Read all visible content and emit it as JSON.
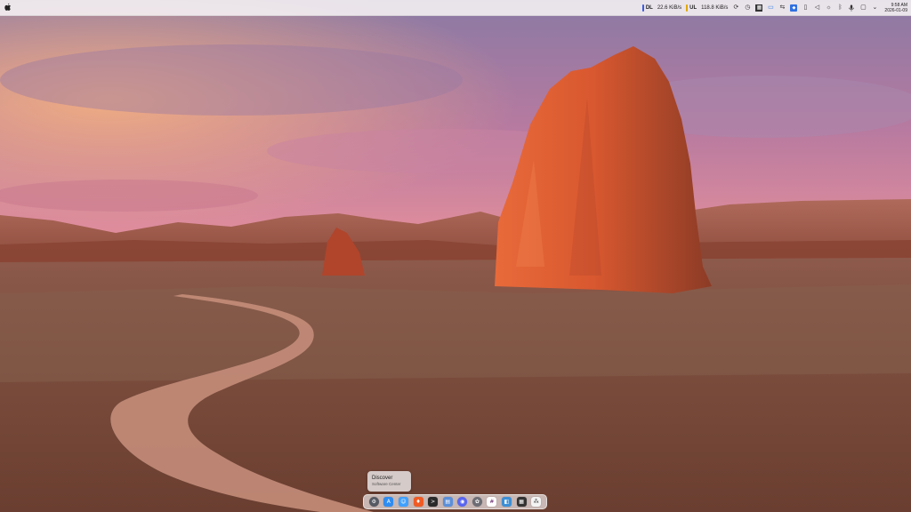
{
  "menubar": {
    "network": {
      "down_label": "DL",
      "down_rate": "22.6 KiB/s",
      "up_label": "UL",
      "up_rate": "118.8 KiB/s",
      "down_color": "#3b5bdb",
      "up_color": "#e0a800"
    },
    "tray_icons": [
      "refresh-icon",
      "clock-icon",
      "grid-icon",
      "screen-icon",
      "sync-icon",
      "app-badge-icon",
      "clipboard-icon",
      "volume-icon",
      "brightness-icon",
      "bluetooth-icon",
      "microphone-icon",
      "chat-icon",
      "chevron-down-icon"
    ],
    "clock": {
      "time": "9:58 AM",
      "date": "2026-01-09"
    }
  },
  "tooltip": {
    "title": "Discover",
    "subtitle": "Software Center"
  },
  "dock": {
    "apps": [
      {
        "name": "discover",
        "glyph": "⚙",
        "color": "#555a63"
      },
      {
        "name": "app-store",
        "glyph": "A",
        "color": "#2f8cf0"
      },
      {
        "name": "finder",
        "glyph": "☺",
        "color": "#3fa0ff"
      },
      {
        "name": "brave-browser",
        "glyph": "♦",
        "color": "#f05a24"
      },
      {
        "name": "terminal",
        "glyph": ">",
        "color": "#2a2a2a"
      },
      {
        "name": "files",
        "glyph": "▤",
        "color": "#5b8fd9"
      },
      {
        "name": "discord",
        "glyph": "◉",
        "color": "#5865f2"
      },
      {
        "name": "settings",
        "glyph": "✿",
        "color": "#6d6d75"
      },
      {
        "name": "slack",
        "glyph": "#",
        "color": "#ffffff"
      },
      {
        "name": "screenshot",
        "glyph": "◧",
        "color": "#3c8fd6"
      },
      {
        "name": "calculator",
        "glyph": "▦",
        "color": "#333333"
      },
      {
        "name": "grid-apps",
        "glyph": "⁂",
        "color": "#f4f4f4"
      }
    ]
  }
}
